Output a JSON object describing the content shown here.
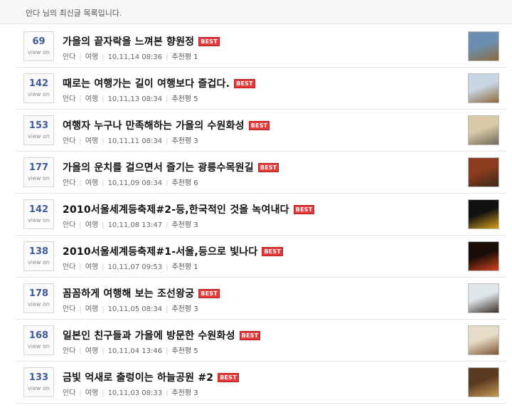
{
  "header": {
    "text": "안다 님의 최신글 목록입니다."
  },
  "view_on_label": "view on",
  "best_label": "BEST",
  "items": [
    {
      "count": "69",
      "title": "가을의 끝자락을 느껴본 향원정",
      "author": "안다",
      "category": "여행",
      "date": "10,11,14 08:36",
      "rec_label": "추천평",
      "rec": "1",
      "thumb_colors": [
        "#6b8fb0",
        "#8a6a3a"
      ]
    },
    {
      "count": "142",
      "title": "때로는 여행가는 길이 여행보다 즐겁다.",
      "author": "안다",
      "category": "여행",
      "date": "10,11,13 08:34",
      "rec_label": "추천평",
      "rec": "5",
      "thumb_colors": [
        "#c9d6e3",
        "#8b6b3c"
      ]
    },
    {
      "count": "153",
      "title": "여행자 누구나 만족해하는 가을의 수원화성",
      "author": "안다",
      "category": "여행",
      "date": "10,11,11 08:34",
      "rec_label": "추천평",
      "rec": "3",
      "thumb_colors": [
        "#d9c9a6",
        "#6f6a5a"
      ]
    },
    {
      "count": "177",
      "title": "가을의 운치를 걸으면서 즐기는 광릉수목원길",
      "author": "안다",
      "category": "여행",
      "date": "10,11,09 08:34",
      "rec_label": "추천평",
      "rec": "6",
      "thumb_colors": [
        "#8a3c1e",
        "#3b2a1c"
      ]
    },
    {
      "count": "142",
      "title": "2010서울세계등축제#2-등,한국적인 것을 녹여내다",
      "author": "안다",
      "category": "여행",
      "date": "10,11,08 13:47",
      "rec_label": "추천평",
      "rec": "3",
      "thumb_colors": [
        "#111111",
        "#d7a21a"
      ]
    },
    {
      "count": "138",
      "title": "2010서울세계등축제#1-서울,등으로 빛나다",
      "author": "안다",
      "category": "여행",
      "date": "10,11,07 09:53",
      "rec_label": "추천평",
      "rec": "1",
      "thumb_colors": [
        "#1a0d08",
        "#d4451c"
      ]
    },
    {
      "count": "178",
      "title": "꼼꼼하게 여행해 보는 조선왕궁",
      "author": "안다",
      "category": "여행",
      "date": "10,11,05 08:34",
      "rec_label": "추천평",
      "rec": "3",
      "thumb_colors": [
        "#dfe6ea",
        "#3a2f26"
      ]
    },
    {
      "count": "168",
      "title": "일본인 친구들과 가을에 방문한 수원화성",
      "author": "안다",
      "category": "여행",
      "date": "10,11,04 13:46",
      "rec_label": "추천평",
      "rec": "5",
      "thumb_colors": [
        "#e7dcc7",
        "#7a5530"
      ]
    },
    {
      "count": "133",
      "title": "금빛 억새로 출렁이는 하늘공원 #2",
      "author": "안다",
      "category": "여행",
      "date": "10,11,03 08:33",
      "rec_label": "추천평",
      "rec": "3",
      "thumb_colors": [
        "#5b3a1f",
        "#c79a5a"
      ]
    }
  ]
}
